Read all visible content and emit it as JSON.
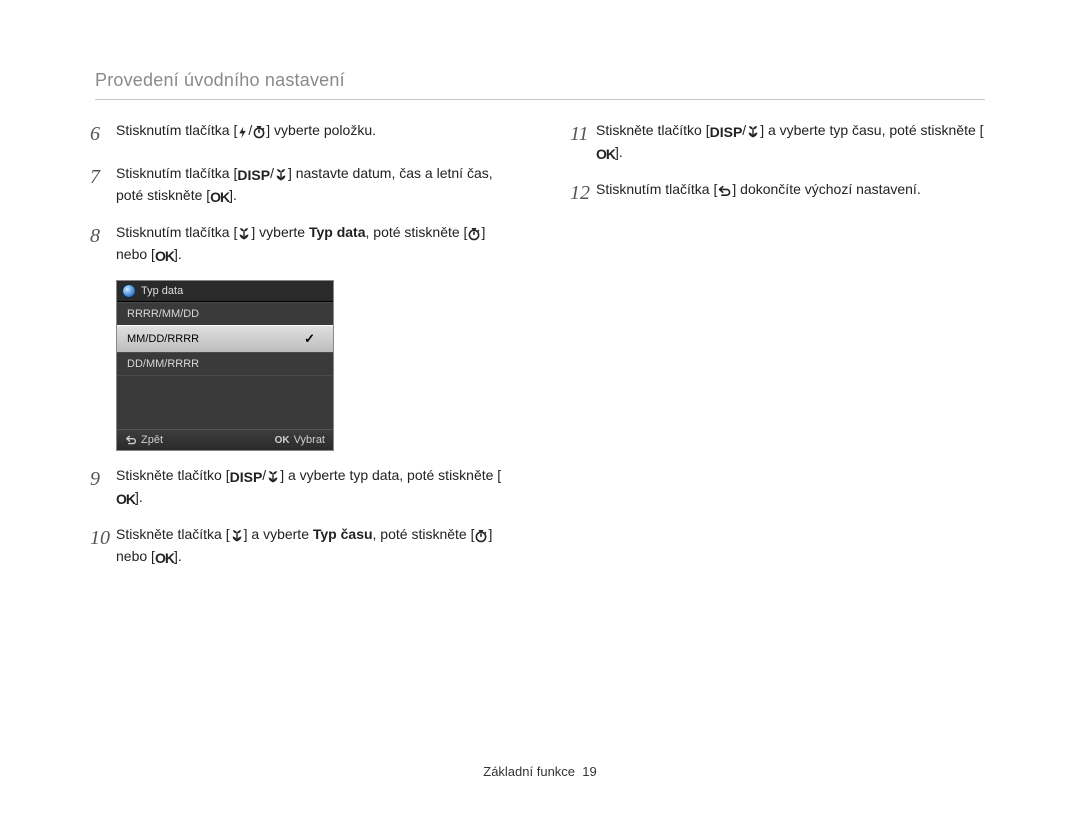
{
  "header": {
    "title": "Provedení úvodního nastavení"
  },
  "icons": {
    "flash": "⚡",
    "timer_svg": "timer",
    "disp": "DISP",
    "macro_svg": "macro",
    "ok": "OK",
    "back_svg": "back",
    "check": "✓",
    "ok_small": "OK"
  },
  "left": {
    "s6": {
      "n": "6",
      "a": "Stisknutím tlačítka [",
      "b": "] vyberte položku."
    },
    "s7": {
      "n": "7",
      "a": "Stisknutím tlačítka [",
      "b": "] nastavte datum, čas a letní čas, poté stiskněte [",
      "c": "]."
    },
    "s8": {
      "n": "8",
      "a": "Stisknutím tlačítka [",
      "b": "] vyberte ",
      "bold": "Typ data",
      "c": ", poté stiskněte [",
      "d": "] nebo [",
      "e": "]."
    },
    "s9": {
      "n": "9",
      "a": "Stiskněte tlačítko [",
      "b": "] a vyberte typ data, poté stiskněte [",
      "c": "]."
    },
    "s10": {
      "n": "10",
      "a": "Stiskněte tlačítka [",
      "b": "] a vyberte ",
      "bold": "Typ času",
      "c": ", poté stiskněte [",
      "d": "] nebo [",
      "e": "]."
    }
  },
  "right": {
    "s11": {
      "n": "11",
      "a": "Stiskněte tlačítko [",
      "b": "] a vyberte typ času, poté stiskněte [",
      "c": "]."
    },
    "s12": {
      "n": "12",
      "a": "Stisknutím tlačítka [",
      "b": "] dokončíte výchozí nastavení."
    }
  },
  "menu": {
    "title": "Typ data",
    "opt1": "RRRR/MM/DD",
    "opt2": "MM/DD/RRRR",
    "opt3": "DD/MM/RRRR",
    "back": "Zpět",
    "select": "Vybrat"
  },
  "footer": {
    "section": "Základní funkce",
    "page": "19"
  }
}
